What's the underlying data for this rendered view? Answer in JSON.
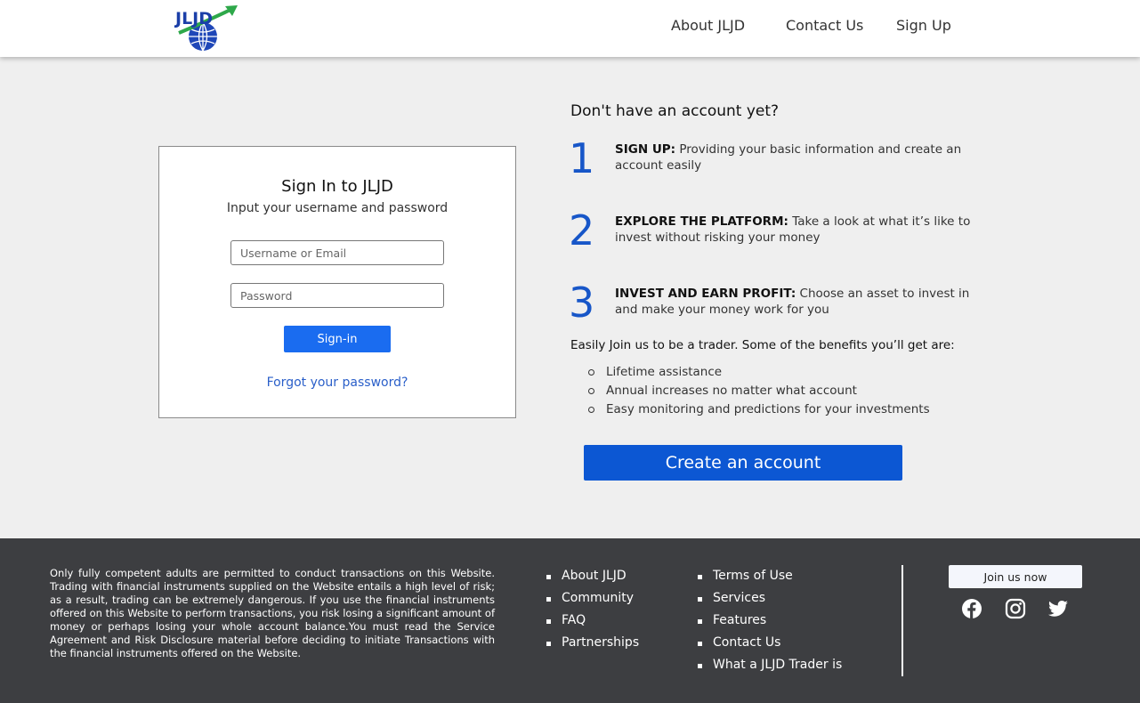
{
  "header": {
    "logo_text": "JLJD",
    "nav": {
      "about": "About JLJD",
      "contact": "Contact Us",
      "signup": "Sign Up"
    }
  },
  "signin": {
    "title": "Sign In to JLJD",
    "subtitle": "Input your username and password",
    "username_placeholder": "Username or Email",
    "password_placeholder": "Password",
    "button": "Sign-in",
    "forgot": "Forgot your password?"
  },
  "register": {
    "title": "Don't have an account yet?",
    "steps": [
      {
        "number": "1",
        "heading": "SIGN UP:",
        "text": "Providing your basic information and create an account easily"
      },
      {
        "number": "2",
        "heading": "EXPLORE THE PLATFORM:",
        "text": "Take a look at what it’s like to invest without risking your money"
      },
      {
        "number": "3",
        "heading": "INVEST AND EARN PROFIT:",
        "text": "Choose an asset to invest in and make your money work for you"
      }
    ],
    "benefits_title": "Easily Join us to be a trader. Some of the benefits you’ll get are:",
    "benefits": [
      "Lifetime assistance",
      "Annual increases no matter what account",
      "Easy monitoring and predictions for your investments"
    ],
    "create_button": "Create an account"
  },
  "footer": {
    "disclaimer": "Only fully competent adults are permitted to conduct transactions on this Website. Trading with financial instruments supplied on the Website entails a high level of risk; as a result, trading can be extremely dangerous. If you use the financial instruments offered on this Website to perform transactions, you risk losing a significant amount of money or perhaps losing your whole account balance.You must read the Service Agreement and Risk Disclosure material before deciding to initiate Transactions with the financial instruments offered on the Website.",
    "links_col1": [
      "About JLJD",
      "Community",
      "FAQ",
      "Partnerships"
    ],
    "links_col2": [
      "Terms of Use",
      "Services",
      "Features",
      "Contact Us",
      "What a JLJD Trader is"
    ],
    "join_button": "Join us now",
    "social_icons": [
      "facebook-icon",
      "instagram-icon",
      "twitter-icon"
    ]
  },
  "colors": {
    "primary_blue": "#1a6cf0",
    "create_blue": "#0c57d3",
    "step_number": "#1756c8",
    "link": "#2a5fc9",
    "footer_bg": "#3d3e41",
    "page_bg": "#efefef"
  }
}
